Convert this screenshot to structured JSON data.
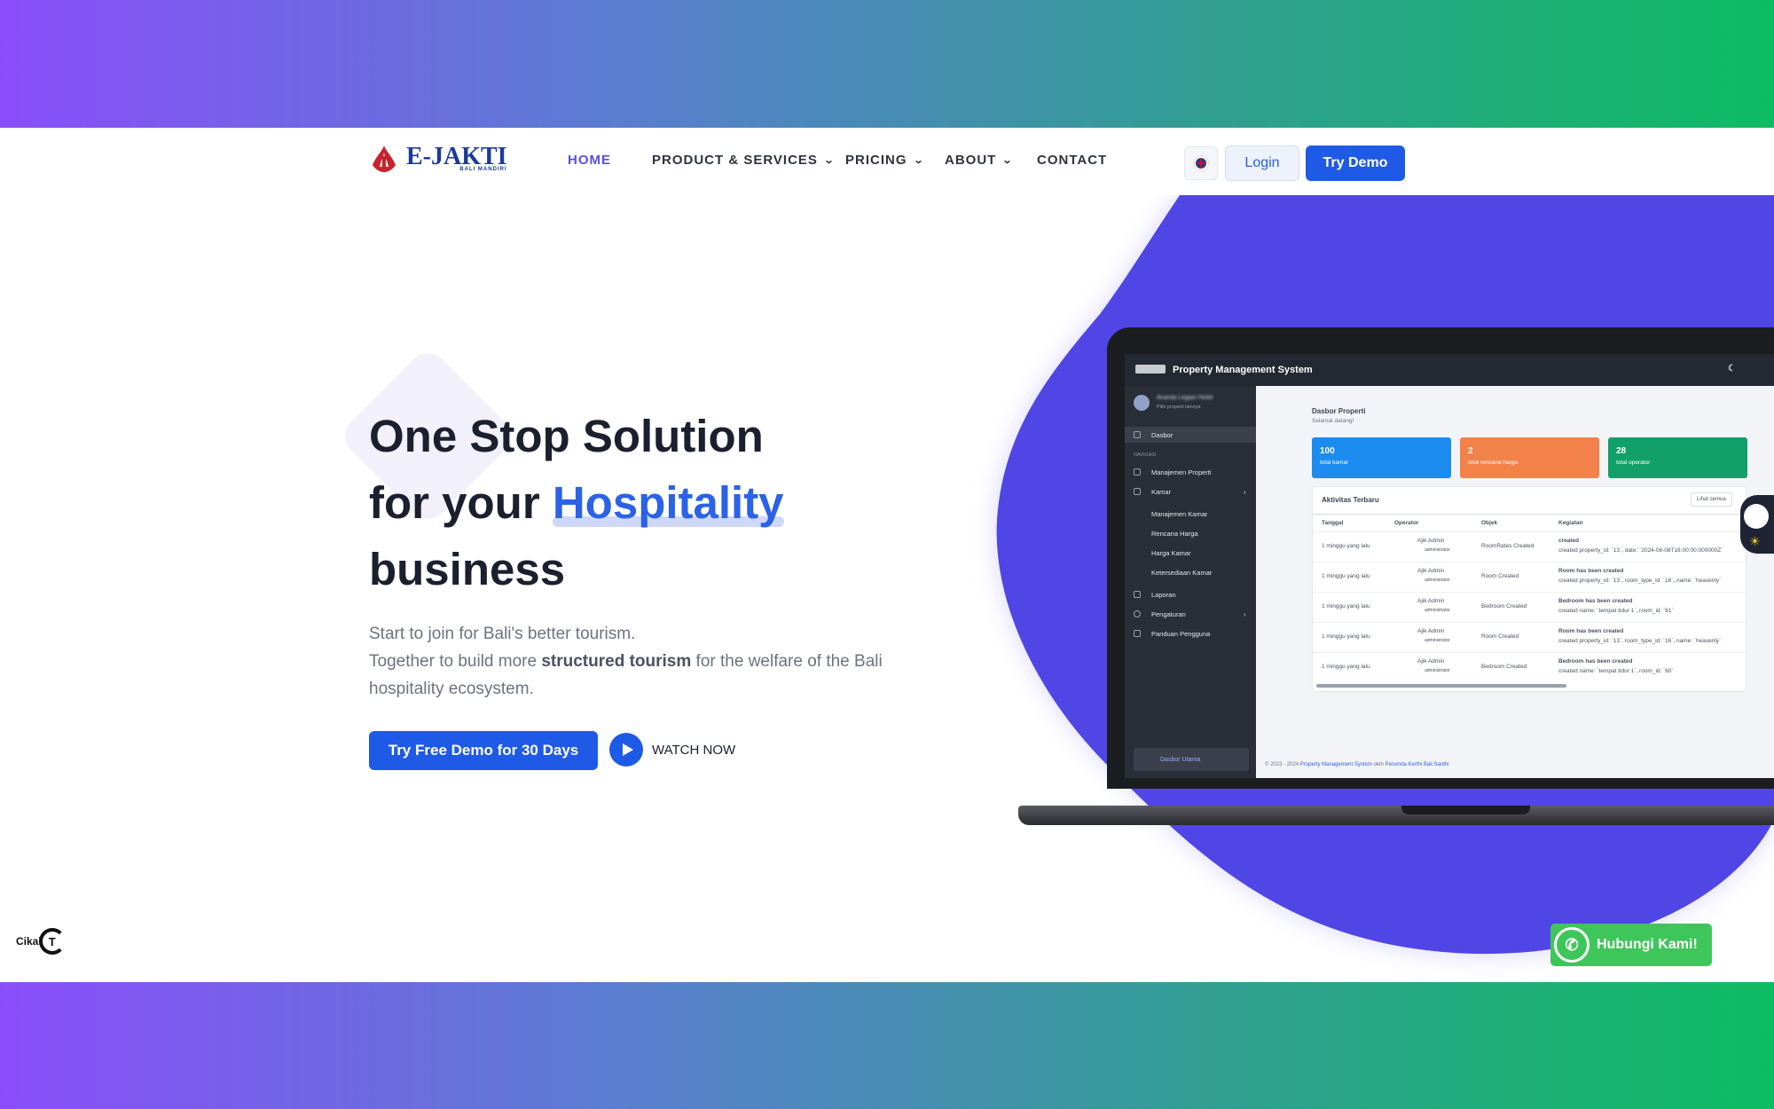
{
  "nav": {
    "logo_text": "E-JAKTI",
    "logo_subtext": "BALI MANDIRI",
    "items": [
      {
        "label": "HOME",
        "active": true,
        "has_dropdown": false
      },
      {
        "label": "PRODUCT & SERVICES",
        "active": false,
        "has_dropdown": true
      },
      {
        "label": "PRICING",
        "active": false,
        "has_dropdown": true
      },
      {
        "label": "ABOUT",
        "active": false,
        "has_dropdown": true
      },
      {
        "label": "CONTACT",
        "active": false,
        "has_dropdown": false
      }
    ],
    "language_icon": "uk-flag-icon",
    "login_label": "Login",
    "try_demo_label": "Try Demo"
  },
  "hero": {
    "title_line1": "One Stop Solution",
    "title_line2_prefix": "for your ",
    "title_highlight": "Hospitality",
    "title_line3": "business",
    "desc_line1": "Start to join for Bali's better tourism.",
    "desc_line2_prefix": "Together to build more ",
    "desc_bold": "structured tourism",
    "desc_line2_suffix": " for the welfare of the Bali hospitality ecosystem.",
    "cta_label": "Try Free Demo for 30 Days",
    "watch_label": "WATCH NOW"
  },
  "app": {
    "title": "Property Management System",
    "sidebar": {
      "property_name": "Ananta Legian Hotel",
      "property_sub": "Pilih properti lainnya",
      "section_label": "NAVIGASI",
      "items": [
        {
          "label": "Dasbor"
        },
        {
          "label": "Manajemen Properti"
        },
        {
          "label": "Kamar"
        },
        {
          "label": "Manajemen Kamar"
        },
        {
          "label": "Rencana Harga"
        },
        {
          "label": "Harga Kamar"
        },
        {
          "label": "Ketersediaan Kamar"
        },
        {
          "label": "Laporan"
        },
        {
          "label": "Pengaturan"
        },
        {
          "label": "Panduan Pengguna"
        }
      ],
      "bottom_label": "Dasbor Utama"
    },
    "page_title": "Dasbor Properti",
    "page_sub": "Selamat datang!",
    "cards": [
      {
        "value": "100",
        "label": "total kamar",
        "color": "#1c8cf0"
      },
      {
        "value": "2",
        "label": "total rencana harga",
        "color": "#f2814a"
      },
      {
        "value": "28",
        "label": "total operator",
        "color": "#12a06a"
      }
    ],
    "activity": {
      "title": "Aktivitas Terbaru",
      "see_all": "Lihat semua",
      "columns": [
        "Tanggal",
        "Operator",
        "Objek",
        "Kegiatan"
      ],
      "rows": [
        {
          "date": "1 minggu yang lalu",
          "operator": "Ajik Admin",
          "role": "administrator",
          "object": "RoomRates Created",
          "activity": "created",
          "detail": "created property_id: `13`, date: `2024-08-08T16:00:00.000000Z`"
        },
        {
          "date": "1 minggu yang lalu",
          "operator": "Ajik Admin",
          "role": "administrator",
          "object": "Room Created",
          "activity": "Room has been created",
          "detail": "created property_id: `13`, room_type_id: `16`, name: `heavenly`"
        },
        {
          "date": "1 minggu yang lalu",
          "operator": "Ajik Admin",
          "role": "administrator",
          "object": "Bedroom Created",
          "activity": "Bedroom has been created",
          "detail": "created name: `tempat tidur 1`, room_id: `61`"
        },
        {
          "date": "1 minggu yang lalu",
          "operator": "Ajik Admin",
          "role": "administrator",
          "object": "Room Created",
          "activity": "Room has been created",
          "detail": "created property_id: `13`, room_type_id: `16`, name: `heavenly`"
        },
        {
          "date": "1 minggu yang lalu",
          "operator": "Ajik Admin",
          "role": "administrator",
          "object": "Bedroom Created",
          "activity": "Bedroom has been created",
          "detail": "created name: `tempat tidur 1`, room_id: `60`"
        }
      ]
    },
    "footer_prefix": "© 2023 - 2024 ",
    "footer_link1": "Property Management System",
    "footer_mid": " oleh ",
    "footer_link2": "Perumda Kerthi Bali Santhi"
  },
  "floating": {
    "whatsapp_label": "Hubungi Kami!",
    "whatsapp_icon": "whatsapp-icon",
    "cikal_label": "Cikal"
  },
  "colors": {
    "primary": "#1f5ae6",
    "blob": "#4f46e5",
    "whatsapp": "#3fc65b"
  }
}
